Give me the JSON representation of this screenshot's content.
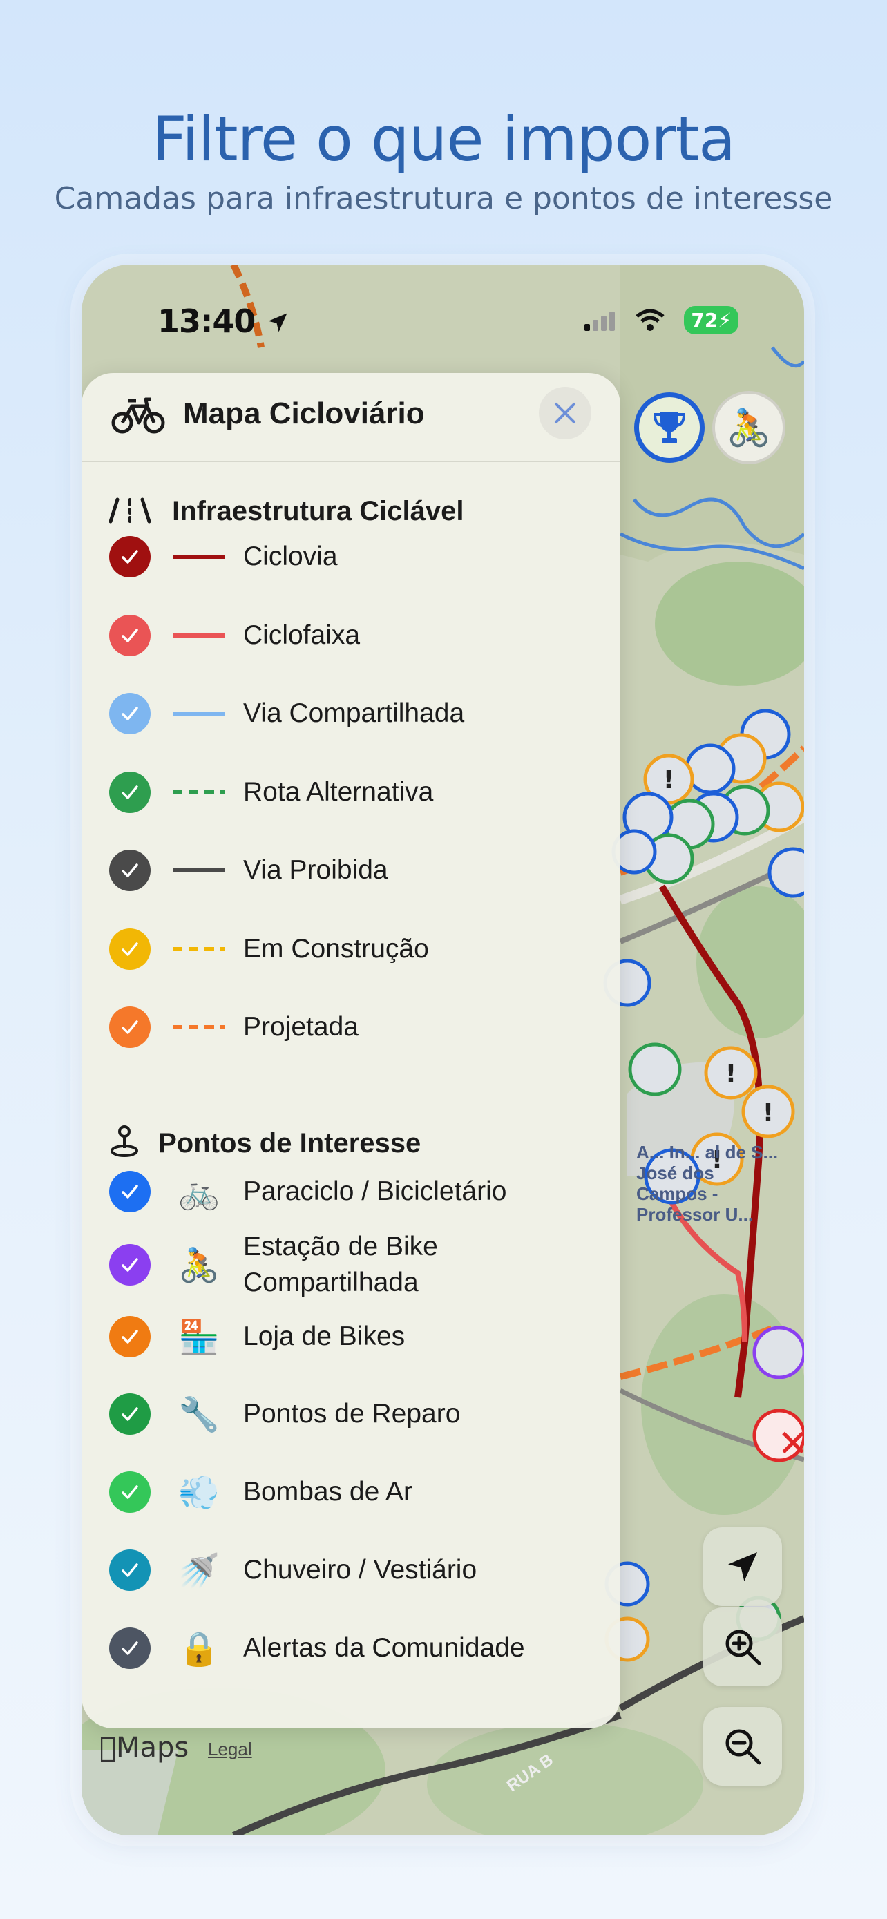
{
  "marketing": {
    "headline": "Filtre o que importa",
    "subheadline": "Camadas para infraestrutura e pontos de interesse"
  },
  "status_bar": {
    "time": "13:40",
    "battery": "72"
  },
  "panel": {
    "title": "Mapa Cicloviário",
    "infra_section": {
      "icon": "road-icon",
      "title": "Infraestrutura Ciclável",
      "items": [
        {
          "label": "Ciclovia",
          "color": "#a01010",
          "style": "solid",
          "checked": true
        },
        {
          "label": "Ciclofaixa",
          "color": "#ea5455",
          "style": "solid",
          "checked": true
        },
        {
          "label": "Via Compartilhada",
          "color": "#7eb6f0",
          "style": "solid",
          "checked": true
        },
        {
          "label": "Rota Alternativa",
          "color": "#2e9e4f",
          "style": "dashed",
          "checked": true
        },
        {
          "label": "Via Proibida",
          "color": "#4a4a4a",
          "style": "solid",
          "checked": true
        },
        {
          "label": "Em Construção",
          "color": "#f2b705",
          "style": "dashed",
          "checked": true
        },
        {
          "label": "Projetada",
          "color": "#f5782a",
          "style": "dashed",
          "checked": true
        }
      ]
    },
    "poi_section": {
      "icon": "pin-icon",
      "title": "Pontos de Interesse",
      "items": [
        {
          "label": "Paraciclo / Bicicletário",
          "emoji": "🚲",
          "color": "#1d6ff2",
          "checked": true
        },
        {
          "label": "Estação de Bike Compartilhada",
          "emoji": "🚴",
          "color": "#8b3ff0",
          "checked": true
        },
        {
          "label": "Loja de Bikes",
          "emoji": "🏪",
          "color": "#f07b12",
          "checked": true
        },
        {
          "label": "Pontos de Reparo",
          "emoji": "🔧",
          "color": "#1f9c45",
          "checked": true
        },
        {
          "label": "Bombas de Ar",
          "emoji": "💨",
          "color": "#34c759",
          "checked": true
        },
        {
          "label": "Chuveiro / Vestiário",
          "emoji": "🚿",
          "color": "#1393b5",
          "checked": true
        },
        {
          "label": "Alertas da Comunidade",
          "emoji": "🔒",
          "color": "#4d5563",
          "checked": true
        }
      ]
    }
  },
  "map": {
    "attribution": "Maps",
    "legal": "Legal",
    "place_label": "A... In... al de S... José dos Campos - Professor U...",
    "street_label": "RUA B"
  }
}
